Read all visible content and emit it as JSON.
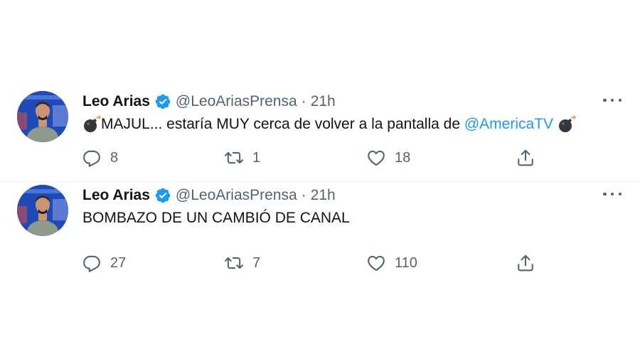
{
  "tweets": [
    {
      "display_name": "Leo Arias",
      "handle": "@LeoAriasPrensa",
      "separator": "·",
      "time": "21h",
      "text_before": "MAJUL... estaría MUY cerca de volver a la pantalla de ",
      "mention": "@AmericaTV",
      "reply_count": "8",
      "retweet_count": "1",
      "like_count": "18"
    },
    {
      "display_name": "Leo Arias",
      "handle": "@LeoAriasPrensa",
      "separator": "·",
      "time": "21h",
      "text_before": "BOMBAZO DE UN CAMBIÓ DE CANAL",
      "reply_count": "27",
      "retweet_count": "7",
      "like_count": "110"
    }
  ],
  "colors": {
    "link": "#1d9bf0",
    "secondary_text": "#536471",
    "divider": "#eff3f4",
    "verified_badge": "#1d9bf0"
  },
  "icons": [
    "verified-badge-icon",
    "more-icon",
    "reply-icon",
    "retweet-icon",
    "like-icon",
    "share-icon",
    "bomb-emoji-icon"
  ]
}
